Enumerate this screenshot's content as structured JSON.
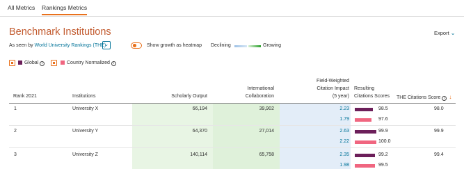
{
  "tabs": [
    {
      "label": "All Metrics",
      "active": false
    },
    {
      "label": "Rankings Metrics",
      "active": true
    }
  ],
  "page_title": "Benchmark Institutions",
  "export_label": "Export",
  "seen_by": {
    "prefix": "As seen by",
    "ranking": "World University Rankings (THE)"
  },
  "heatmap_toggle": {
    "label": "Show growth as heatmap",
    "on": false
  },
  "heatmap_legend": {
    "declining": "Declining",
    "growing": "Growing"
  },
  "filters": {
    "global": {
      "label": "Global",
      "checked": true,
      "color": "#6c1f5a"
    },
    "country": {
      "label": "Country Normalized",
      "checked": true,
      "color": "#f06680"
    }
  },
  "table": {
    "headers": {
      "rank": "Rank 2021",
      "institutions": "Institutions",
      "scholarly_output": "Scholarly Output",
      "intl_collab_1": "International",
      "intl_collab_2": "Collaboration",
      "fwci_1": "Field-Weighted",
      "fwci_2": "Citation Impact",
      "fwci_3": "(5 year)",
      "resulting_1": "Resulting",
      "resulting_2": "Citations Scores",
      "the_score": "THE Citations Score"
    },
    "rows": [
      {
        "rank": "1",
        "institution": "University X",
        "scholarly_output": "66,194",
        "intl_collab": "39,902",
        "fwci_global": "2.23",
        "fwci_country": "1.79",
        "score_global": "98.5",
        "score_country": "97.6",
        "score_global_value": 98.5,
        "score_country_value": 97.6,
        "the_score": "98.0"
      },
      {
        "rank": "2",
        "institution": "University Y",
        "scholarly_output": "64,370",
        "intl_collab": "27,014",
        "fwci_global": "2.63",
        "fwci_country": "2.22",
        "score_global": "99.9",
        "score_country": "100.0",
        "score_global_value": 99.9,
        "score_country_value": 100.0,
        "the_score": "99.9"
      },
      {
        "rank": "3",
        "institution": "University Z",
        "scholarly_output": "140,114",
        "intl_collab": "65,758",
        "fwci_global": "2.35",
        "fwci_country": "1.98",
        "score_global": "99.2",
        "score_country": "99.5",
        "score_global_value": 99.2,
        "score_country_value": 99.5,
        "the_score": "99.4"
      }
    ]
  }
}
